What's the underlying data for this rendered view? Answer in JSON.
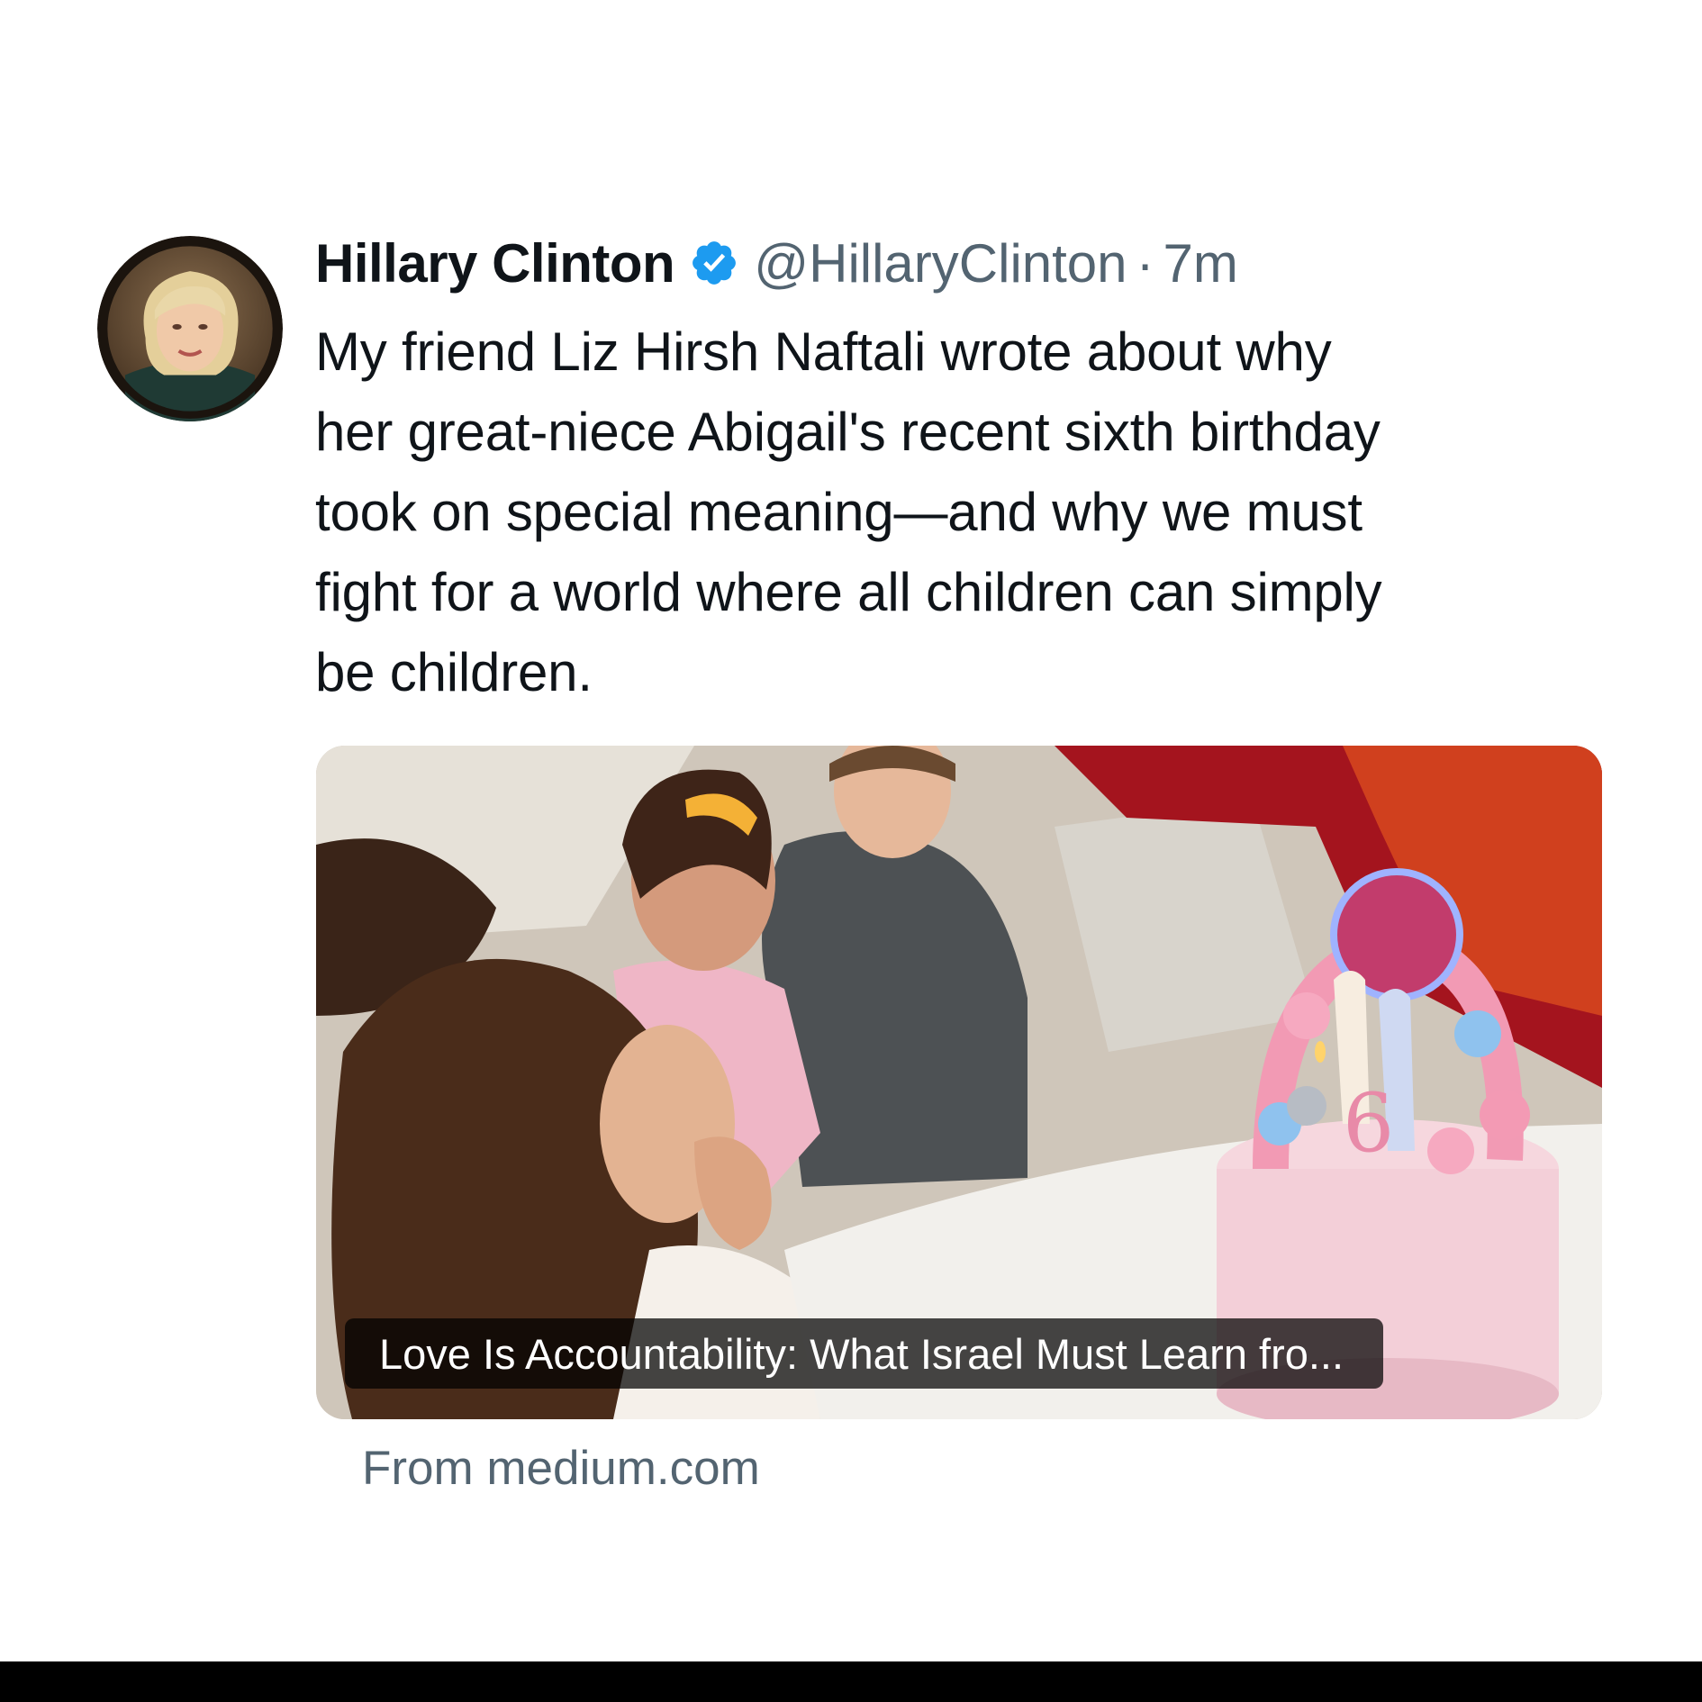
{
  "tweet": {
    "author": {
      "name": "Hillary Clinton",
      "handle": "@HillaryClinton",
      "verified": true,
      "avatar_icon": "profile-photo"
    },
    "separator": "·",
    "timestamp": "7m",
    "text": "My friend Liz Hirsh Naftali wrote about why\nher great-niece Abigail's recent sixth birthday\ntook on special meaning—and why we must\nfight for a world where all children can simply\nbe children.",
    "card": {
      "title": "Love Is Accountability: What Israel Must Learn fro...",
      "source": "From medium.com"
    }
  },
  "colors": {
    "primary_text": "#0f1419",
    "secondary_text": "#536471",
    "verified_blue": "#1d9bf0",
    "background": "#ffffff"
  }
}
